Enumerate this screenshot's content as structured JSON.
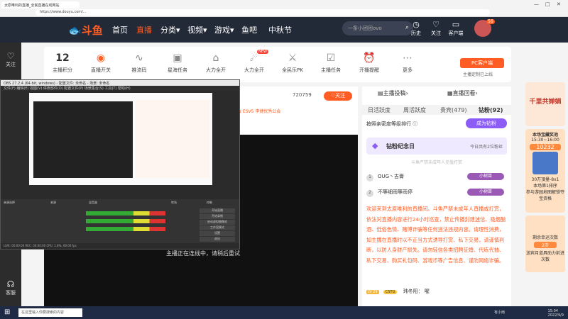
{
  "browser": {
    "tab_title": "太原唯利的直播_全民直播在线网站",
    "address": "https://www.douyu.com/...",
    "controls": [
      "—",
      "□",
      "✕"
    ]
  },
  "header": {
    "logo": "斗鱼",
    "nav": [
      {
        "label": "首页"
      },
      {
        "label": "直播"
      },
      {
        "label": "分类"
      },
      {
        "label": "视频"
      },
      {
        "label": "游戏"
      },
      {
        "label": "鱼吧"
      },
      {
        "label": "中秋节"
      }
    ],
    "search_placeholder": "一条小团团ovo",
    "icons": [
      {
        "label": "历史"
      },
      {
        "label": "关注"
      },
      {
        "label": "客户端"
      }
    ],
    "avatar_badge": "56"
  },
  "left_sidebar": {
    "follow_label": "关注",
    "support_label": "客服"
  },
  "toolbar": {
    "items": [
      {
        "value": "12",
        "label": "主播积分"
      },
      {
        "label": "直播开关"
      },
      {
        "label": "推流码"
      },
      {
        "label": "星海任务"
      },
      {
        "label": "大力全开",
        "badge": "NEW"
      },
      {
        "label": "全民乐PK"
      },
      {
        "label": "主播任务"
      },
      {
        "label": "开播提醒"
      },
      {
        "label": "更多"
      }
    ],
    "pc_button": "PC客户端",
    "pc_sub": "主播定制已上线"
  },
  "stream": {
    "follow_count": "720759",
    "follow_button": "关注",
    "tags": "会  ESV5  李捷优秀公会",
    "offline_msg": "主播正在连线中，请稍后重试"
  },
  "obs": {
    "title": "OBS 27.2.4 (64-bit, windows) - 配置文件: 未命名 - 场景: 未命名",
    "menu": "文件(F)  编辑(E)  视图(V)  停靠部件(D)  配置文件(P)  场景集合(S)  工具(T)  帮助(H)",
    "docks": [
      "来源选择",
      "来源",
      "混音器",
      "转场",
      "控制"
    ],
    "controls": [
      "开始直播",
      "开始录制",
      "启动虚拟摄像机",
      "工作室模式",
      "设置",
      "退出"
    ],
    "status": "LIVE: 00:00:00   REC: 00:00:00   CPU: 1.8%, 60.00 fps"
  },
  "side_panel": {
    "tabs": [
      {
        "label": "主播投稿"
      },
      {
        "label": "直播回看"
      }
    ],
    "subtabs": [
      {
        "label": "日活跃度"
      },
      {
        "label": "周活跃度"
      },
      {
        "label": "贵宾(479)"
      },
      {
        "label": "钻粉(92)"
      }
    ],
    "fans_line": "按照亲密度等级排行",
    "become_button": "成为钻粉",
    "anniversary": {
      "title": "钻粉纪念日",
      "right": "今日共有2位粉丝"
    },
    "anniv_sub": "斗鱼严禁未成年人充值打赏",
    "ranks": [
      {
        "n": "1",
        "name": "OUG丶吉膏",
        "badge": "小树苗"
      },
      {
        "n": "2",
        "name": "不等细雨等雨停",
        "badge": "小树苗"
      }
    ],
    "system_message": "欢迎来到太原唯利的直播间。斗鱼严禁未成年人直播或打赏，依法对直播内容进行24小时巡查，禁止传播封建迷信、吸烟酗酒、低俗色情、赌博诈骗等任何违法违规内容。请理性消费，如主播在直播时以不正当方式诱导打赏、私下交易，请谨慎判断，以防人身财产损失。请勿轻信各类招聘征婚、代练代抽、私下交易、购买礼包码、游戏币等广告信息、谨防网络诈骗。",
    "user_line": {
      "lv": "LV 29",
      "badge": "CSTG",
      "text": "玮冬阳：  喔"
    }
  },
  "right_promo": {
    "banner": "千里共婵娟",
    "card1_title": "本场宝藏奖池",
    "card1_time": "15:30~16:00",
    "card1_value": "10232",
    "card1_line1": "30万頂量-8x1",
    "card1_line2": "本场第1排序",
    "card1_foot": "参与游园地图解锁夺宝资格",
    "card2_title": "剩余幸运次数",
    "card2_value": "2次",
    "card2_foot": "送宾月道具助力前进次数"
  },
  "taskbar": {
    "search": "在这里输入你要搜索的内容",
    "time": "15:04",
    "date": "2022/9/9",
    "weather": "有小雨"
  }
}
